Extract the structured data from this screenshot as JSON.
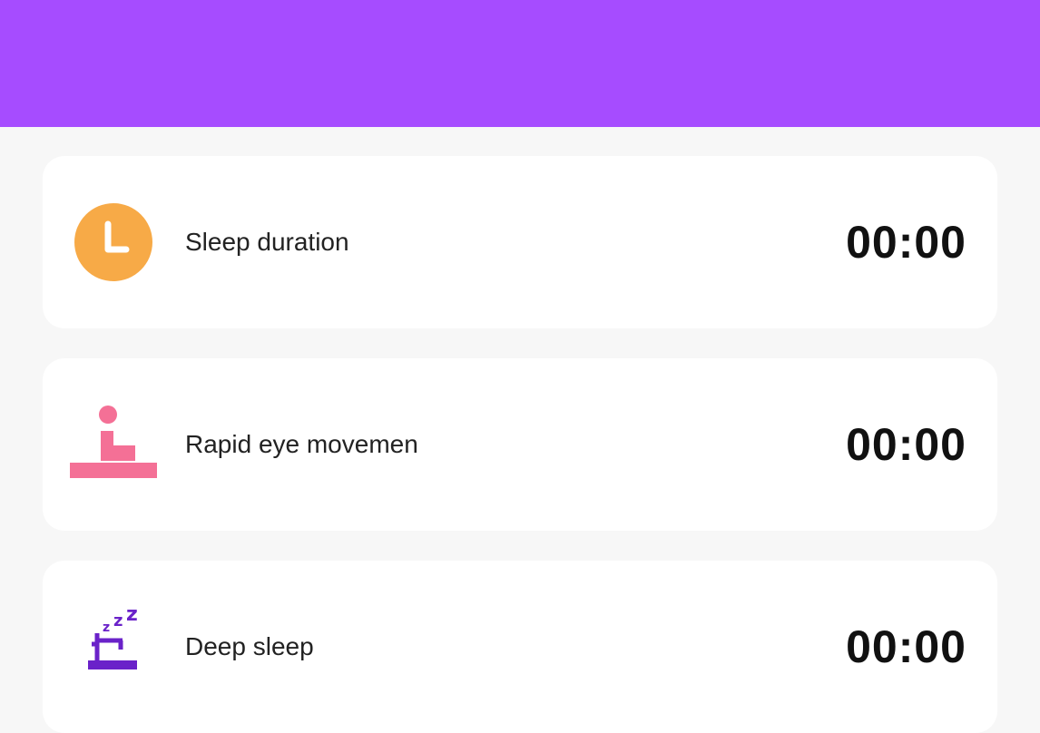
{
  "theme": {
    "header_color": "#a64cff",
    "background": "#f7f7f7",
    "clock_icon_color": "#f7aa47",
    "rem_icon_color": "#f47096",
    "deep_sleep_icon_color": "#6a22c9"
  },
  "metrics": [
    {
      "label": "Sleep duration",
      "value": "00:00",
      "icon": "clock-icon"
    },
    {
      "label": "Rapid eye movemen",
      "value": "00:00",
      "icon": "rem-icon"
    },
    {
      "label": "Deep sleep",
      "value": "00:00",
      "icon": "deep-sleep-icon"
    }
  ]
}
